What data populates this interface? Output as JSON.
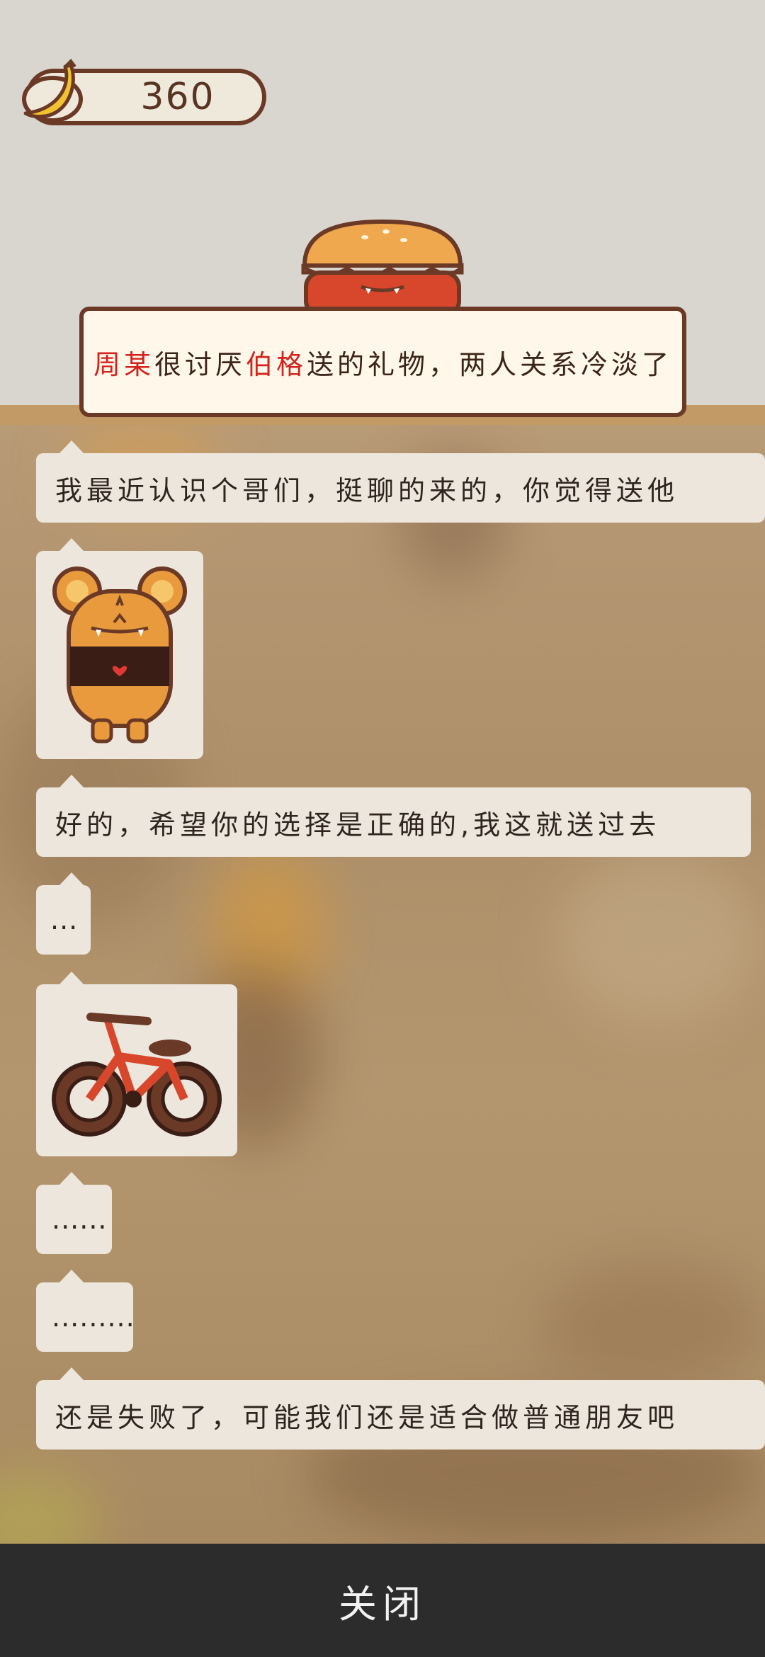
{
  "hud": {
    "bananas": "360",
    "currency_icon": "banana-icon"
  },
  "notification": {
    "name_a": "周某",
    "text_1": "很讨厌",
    "name_b": "伯格",
    "text_2": "送的礼物，两人关系冷淡了"
  },
  "messages": [
    {
      "type": "text",
      "text": "我最近认识个哥们，挺聊的来的，你觉得送他"
    },
    {
      "type": "image",
      "icon": "bear-doll-icon"
    },
    {
      "type": "text",
      "text": "好的，希望你的选择是正确的,我这就送过去"
    },
    {
      "type": "text",
      "text": "..."
    },
    {
      "type": "image",
      "icon": "bicycle-icon"
    },
    {
      "type": "text",
      "text": "......"
    },
    {
      "type": "text",
      "text": "........."
    },
    {
      "type": "text",
      "text": "还是失败了，可能我们还是适合做普通朋友吧"
    }
  ],
  "footer": {
    "close_label": "关闭"
  },
  "colors": {
    "accent_red": "#d3231d",
    "border_brown": "#6b3a26",
    "bar": "#2c2c2c"
  }
}
